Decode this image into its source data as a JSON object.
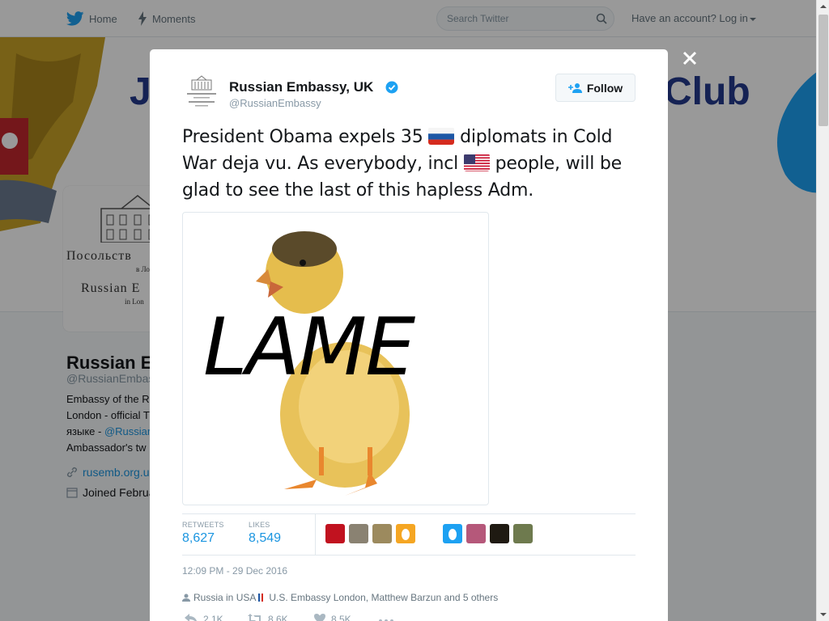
{
  "topbar": {
    "home_label": "Home",
    "moments_label": "Moments",
    "search_placeholder": "Search Twitter",
    "login_label": "Have an account? Log in"
  },
  "background": {
    "banner_title_left": "Jo",
    "banner_title_right": "Club",
    "avatar_line1": "Посольств",
    "avatar_line2": "в Лон",
    "avatar_line3": "Russian E",
    "avatar_line4": "in Lon",
    "profile_name": "Russian E",
    "profile_handle": "@RussianEmbass",
    "bio_line1": "Embassy of the R",
    "bio_line2": "London - official T",
    "bio_line3": "языке - ",
    "bio_link": "@Russiar",
    "bio_line4": "Ambassador's tw",
    "url": "rusemb.org.u",
    "joined": "Joined Februa"
  },
  "tweet": {
    "author_name": "Russian Embassy, UK",
    "author_handle": "@RussianEmbassy",
    "follow_label": "Follow",
    "text_part1": "President Obama expels 35 ",
    "text_part2": " diplomats in Cold War deja vu. As everybody, incl ",
    "text_part3": " people, will be glad to see the last of this hapless Adm.",
    "media_caption": "LAME",
    "retweets_label": "RETWEETS",
    "retweets_value": "8,627",
    "likes_label": "LIKES",
    "likes_value": "8,549",
    "timestamp": "12:09 PM - 29 Dec 2016",
    "context_text": "Russia in USA",
    "context_text2": " U.S. Embassy London, Matthew Barzun and 5 others",
    "reply_count": "2.1K",
    "retweet_count": "8.6K",
    "like_count": "8.5K"
  },
  "colors": {
    "twitter_blue": "#1da1f2",
    "link_blue": "#1b95e0",
    "verified_blue": "#1da1f2"
  }
}
